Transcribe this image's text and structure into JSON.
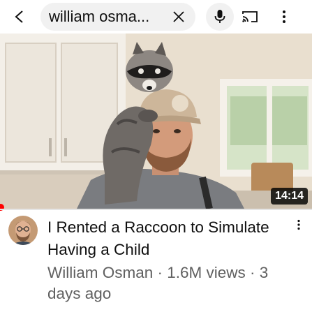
{
  "search": {
    "query": "william osma..."
  },
  "icons": {
    "back": "chevron-left-icon",
    "clear": "close-icon",
    "mic": "microphone-icon",
    "cast": "cast-icon",
    "menu": "more-vertical-icon"
  },
  "video": {
    "duration": "14:14",
    "title": "I Rented a Raccoon to Simulate Having a Child",
    "meta": "William Osman · 1.6M views · 3 days ago",
    "watch_progress": 0
  },
  "colors": {
    "accent": "#ff0000",
    "text_primary": "#0f0f0f",
    "text_secondary": "#606060",
    "pill_bg": "#f1f1f1"
  }
}
